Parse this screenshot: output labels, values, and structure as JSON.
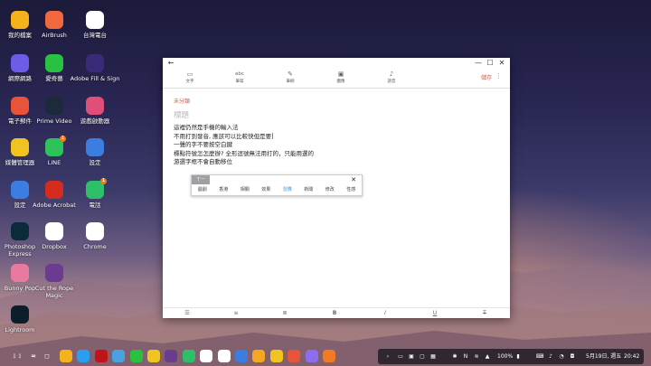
{
  "desktop": {
    "icons": [
      {
        "label": "我的檔案",
        "icon": "folder-icon",
        "color": "#f5b21d"
      },
      {
        "label": "AirBrush",
        "icon": "airbrush-icon",
        "color": "#f2683f"
      },
      {
        "label": "台灣電台",
        "icon": "radio-icon",
        "color": "#ffffff"
      },
      {
        "label": "網際網路",
        "icon": "internet-icon",
        "color": "#6c5ce7"
      },
      {
        "label": "愛奇藝",
        "icon": "iqiyi-icon",
        "color": "#29c140"
      },
      {
        "label": "Adobe Fill & Sign",
        "icon": "fill-sign-icon",
        "color": "#3a2a78"
      },
      {
        "label": "電子郵件",
        "icon": "email-icon",
        "color": "#e8543a"
      },
      {
        "label": "Prime Video",
        "icon": "prime-video-icon",
        "color": "#1c2a3b"
      },
      {
        "label": "遊戲啟動器",
        "icon": "game-launcher-icon",
        "color": "#e04f7a"
      },
      {
        "label": "媒體管理器",
        "icon": "media-manager-icon",
        "color": "#f1c320"
      },
      {
        "label": "LINE",
        "icon": "line-icon",
        "color": "#2ec25a",
        "badge": "1"
      },
      {
        "label": "設定",
        "icon": "settings-icon",
        "color": "#3b7de0"
      },
      {
        "label": "設定",
        "icon": "settings-icon",
        "color": "#3b7de0"
      },
      {
        "label": "Adobe Acrobat",
        "icon": "acrobat-icon",
        "color": "#d62b1f"
      },
      {
        "label": "電話",
        "icon": "phone-icon",
        "color": "#2fbf6a",
        "badge": "1"
      },
      {
        "label": "Photoshop Express",
        "icon": "photoshop-express-icon",
        "color": "#0b2a3a"
      },
      {
        "label": "Dropbox",
        "icon": "dropbox-icon",
        "color": "#ffffff"
      },
      {
        "label": "Chrome",
        "icon": "chrome-icon",
        "color": "#ffffff"
      },
      {
        "label": "Bunny Pop",
        "icon": "bunny-pop-icon",
        "color": "#e87aa0"
      },
      {
        "label": "Cut the Rope Magic",
        "icon": "cut-the-rope-icon",
        "color": "#6a3b8e"
      },
      {
        "label": "Lightroom",
        "icon": "lightroom-icon",
        "color": "#0c1e2c"
      }
    ]
  },
  "notes_window": {
    "titlebar": {
      "back": "←",
      "minimize": "—",
      "maximize": "☐",
      "close": "✕"
    },
    "toolbar": [
      {
        "label": "文字",
        "icon": "keyboard-icon",
        "glyph": "▭"
      },
      {
        "label": "筆寫",
        "icon": "handwriting-icon",
        "glyph": "abc"
      },
      {
        "label": "筆刷",
        "icon": "brush-icon",
        "glyph": "✎"
      },
      {
        "label": "圖像",
        "icon": "image-icon",
        "glyph": "▣"
      },
      {
        "label": "語音",
        "icon": "mic-icon",
        "glyph": "♪"
      }
    ],
    "save_label": "儲存",
    "more_glyph": "⋮",
    "category": "未分類",
    "title_placeholder": "標題",
    "body_lines": [
      "這裡仍然是手機的輸入法",
      "不用打到發音, 應該可以比較快但是要",
      "一聲的字不要按空白鍵",
      "標點符號怎怎麼辦? 全形逗號無法用打的，只能用選的",
      "游選字框不會自動移位"
    ],
    "ime": {
      "input_label": "ㄒㄧ",
      "close_glyph": "✕",
      "candidates": [
        "戲劇",
        "香港",
        "相關",
        "效果",
        "習慣",
        "新聞",
        "修改",
        "性感"
      ],
      "highlighted_index": 4
    },
    "format_bar": [
      {
        "glyph": "☰",
        "icon": "checklist-icon"
      },
      {
        "glyph": "≡",
        "icon": "bullet-list-icon"
      },
      {
        "glyph": "≣",
        "icon": "numbered-list-icon"
      },
      {
        "glyph": "B",
        "icon": "bold-icon"
      },
      {
        "glyph": "I",
        "icon": "italic-icon"
      },
      {
        "glyph": "U",
        "icon": "underline-icon"
      },
      {
        "glyph": "T",
        "icon": "strikethrough-icon"
      }
    ]
  },
  "taskbar": {
    "left": [
      "⋮⋮",
      "≈",
      "◻"
    ],
    "apps": [
      "my-files",
      "play-store",
      "netflix",
      "snowflake",
      "iqiyi",
      "lightbulb",
      "cut-rope",
      "phone",
      "calendar",
      "clock",
      "camera",
      "gallery",
      "media",
      "mail",
      "video",
      "notes"
    ],
    "tray": {
      "battery": "100%",
      "date": "5月19日, 週五",
      "time": "20:42"
    }
  }
}
